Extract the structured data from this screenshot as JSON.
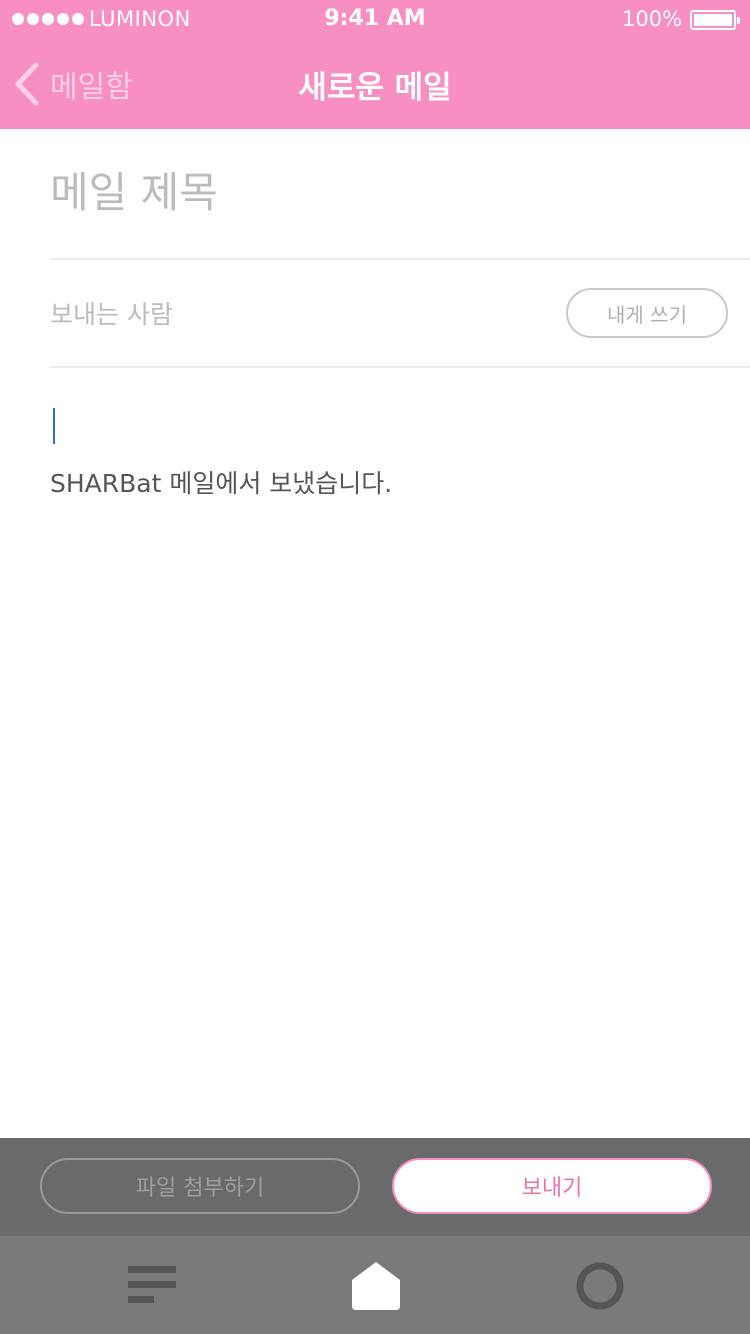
{
  "status_bar": {
    "carrier": "LUMINON",
    "time": "9:41 AM",
    "battery": "100%",
    "signal_bars": 5
  },
  "nav": {
    "back_label": "메일함",
    "title": "새로운 메일",
    "back_icon": "chevron-left-icon"
  },
  "compose": {
    "subject_placeholder": "메일 제목",
    "subject_value": "",
    "sender_placeholder": "보내는 사람",
    "sender_value": "",
    "self_button_label": "내게 쓰기",
    "signature": "SHARBat 메일에서 보냈습니다."
  },
  "actions": {
    "attach_label": "파일 첨부하기",
    "send_label": "보내기"
  },
  "tab_bar": {
    "tabs": [
      {
        "icon": "menu-lines-icon"
      },
      {
        "icon": "home-icon"
      },
      {
        "icon": "circle-icon"
      }
    ]
  },
  "colors": {
    "accent": "#f78fc2",
    "action_bar": "#6a6a6a",
    "tab_bar": "#7a7a7a",
    "cursor": "#2a6fd6"
  }
}
